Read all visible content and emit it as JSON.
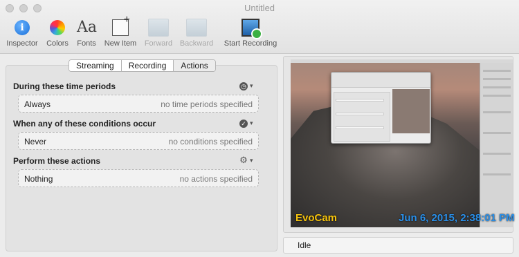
{
  "window": {
    "title": "Untitled"
  },
  "toolbar": {
    "items": [
      {
        "label": "Inspector",
        "icon": "info-icon",
        "enabled": true
      },
      {
        "label": "Colors",
        "icon": "color-wheel-icon",
        "enabled": true
      },
      {
        "label": "Fonts",
        "icon": "fonts-icon",
        "enabled": true
      },
      {
        "label": "New Item",
        "icon": "new-item-icon",
        "enabled": true
      },
      {
        "label": "Forward",
        "icon": "forward-icon",
        "enabled": false
      },
      {
        "label": "Backward",
        "icon": "backward-icon",
        "enabled": false
      },
      {
        "label": "Start Recording",
        "icon": "start-recording-icon",
        "enabled": true
      }
    ],
    "inspector_glyph": "i",
    "fonts_glyph": "Aa"
  },
  "tabs": [
    {
      "label": "Streaming",
      "active": false
    },
    {
      "label": "Recording",
      "active": false
    },
    {
      "label": "Actions",
      "active": true
    }
  ],
  "sections": [
    {
      "title": "During these time periods",
      "icon": "clock-icon",
      "value": "Always",
      "hint": "no time periods specified"
    },
    {
      "title": "When any of these conditions occur",
      "icon": "checkmark-icon",
      "value": "Never",
      "hint": "no conditions specified"
    },
    {
      "title": "Perform these actions",
      "icon": "gear-icon",
      "value": "Nothing",
      "hint": "no actions specified"
    }
  ],
  "preview": {
    "overlay_left": "EvoCam",
    "overlay_right": "Jun 6, 2015, 2:38:01 PM",
    "overlay_left_color": "#f4c20d",
    "overlay_right_color": "#2a8fe8"
  },
  "status": {
    "text": "Idle"
  }
}
